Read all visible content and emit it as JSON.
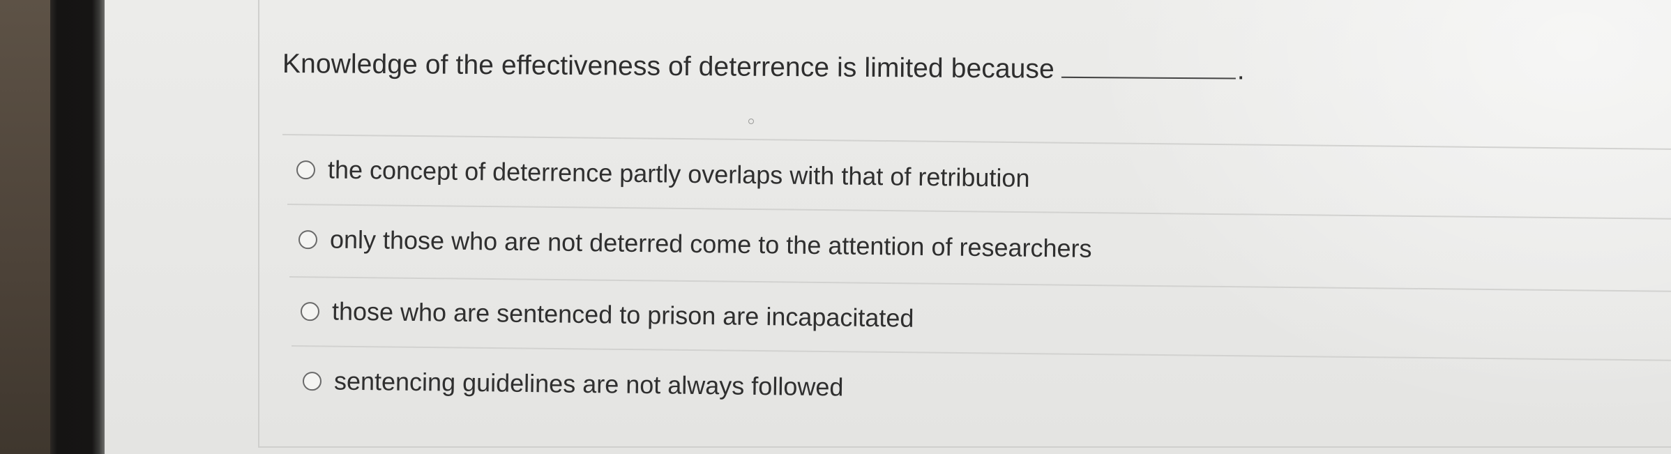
{
  "question": {
    "text": "Knowledge of the effectiveness of deterrence is limited because",
    "period": "."
  },
  "options": [
    {
      "label": "the concept of deterrence partly overlaps with that of retribution",
      "selected": false
    },
    {
      "label": "only those who are not deterred come to the attention of researchers",
      "selected": false
    },
    {
      "label": "those who are sentenced to prison are incapacitated",
      "selected": false
    },
    {
      "label": "sentencing guidelines are not always followed",
      "selected": false
    }
  ],
  "colors": {
    "text": "#2f2f2f",
    "background": "#eaeae8",
    "divider": "#d2d2d0",
    "radio_border": "#6a6a6a"
  }
}
